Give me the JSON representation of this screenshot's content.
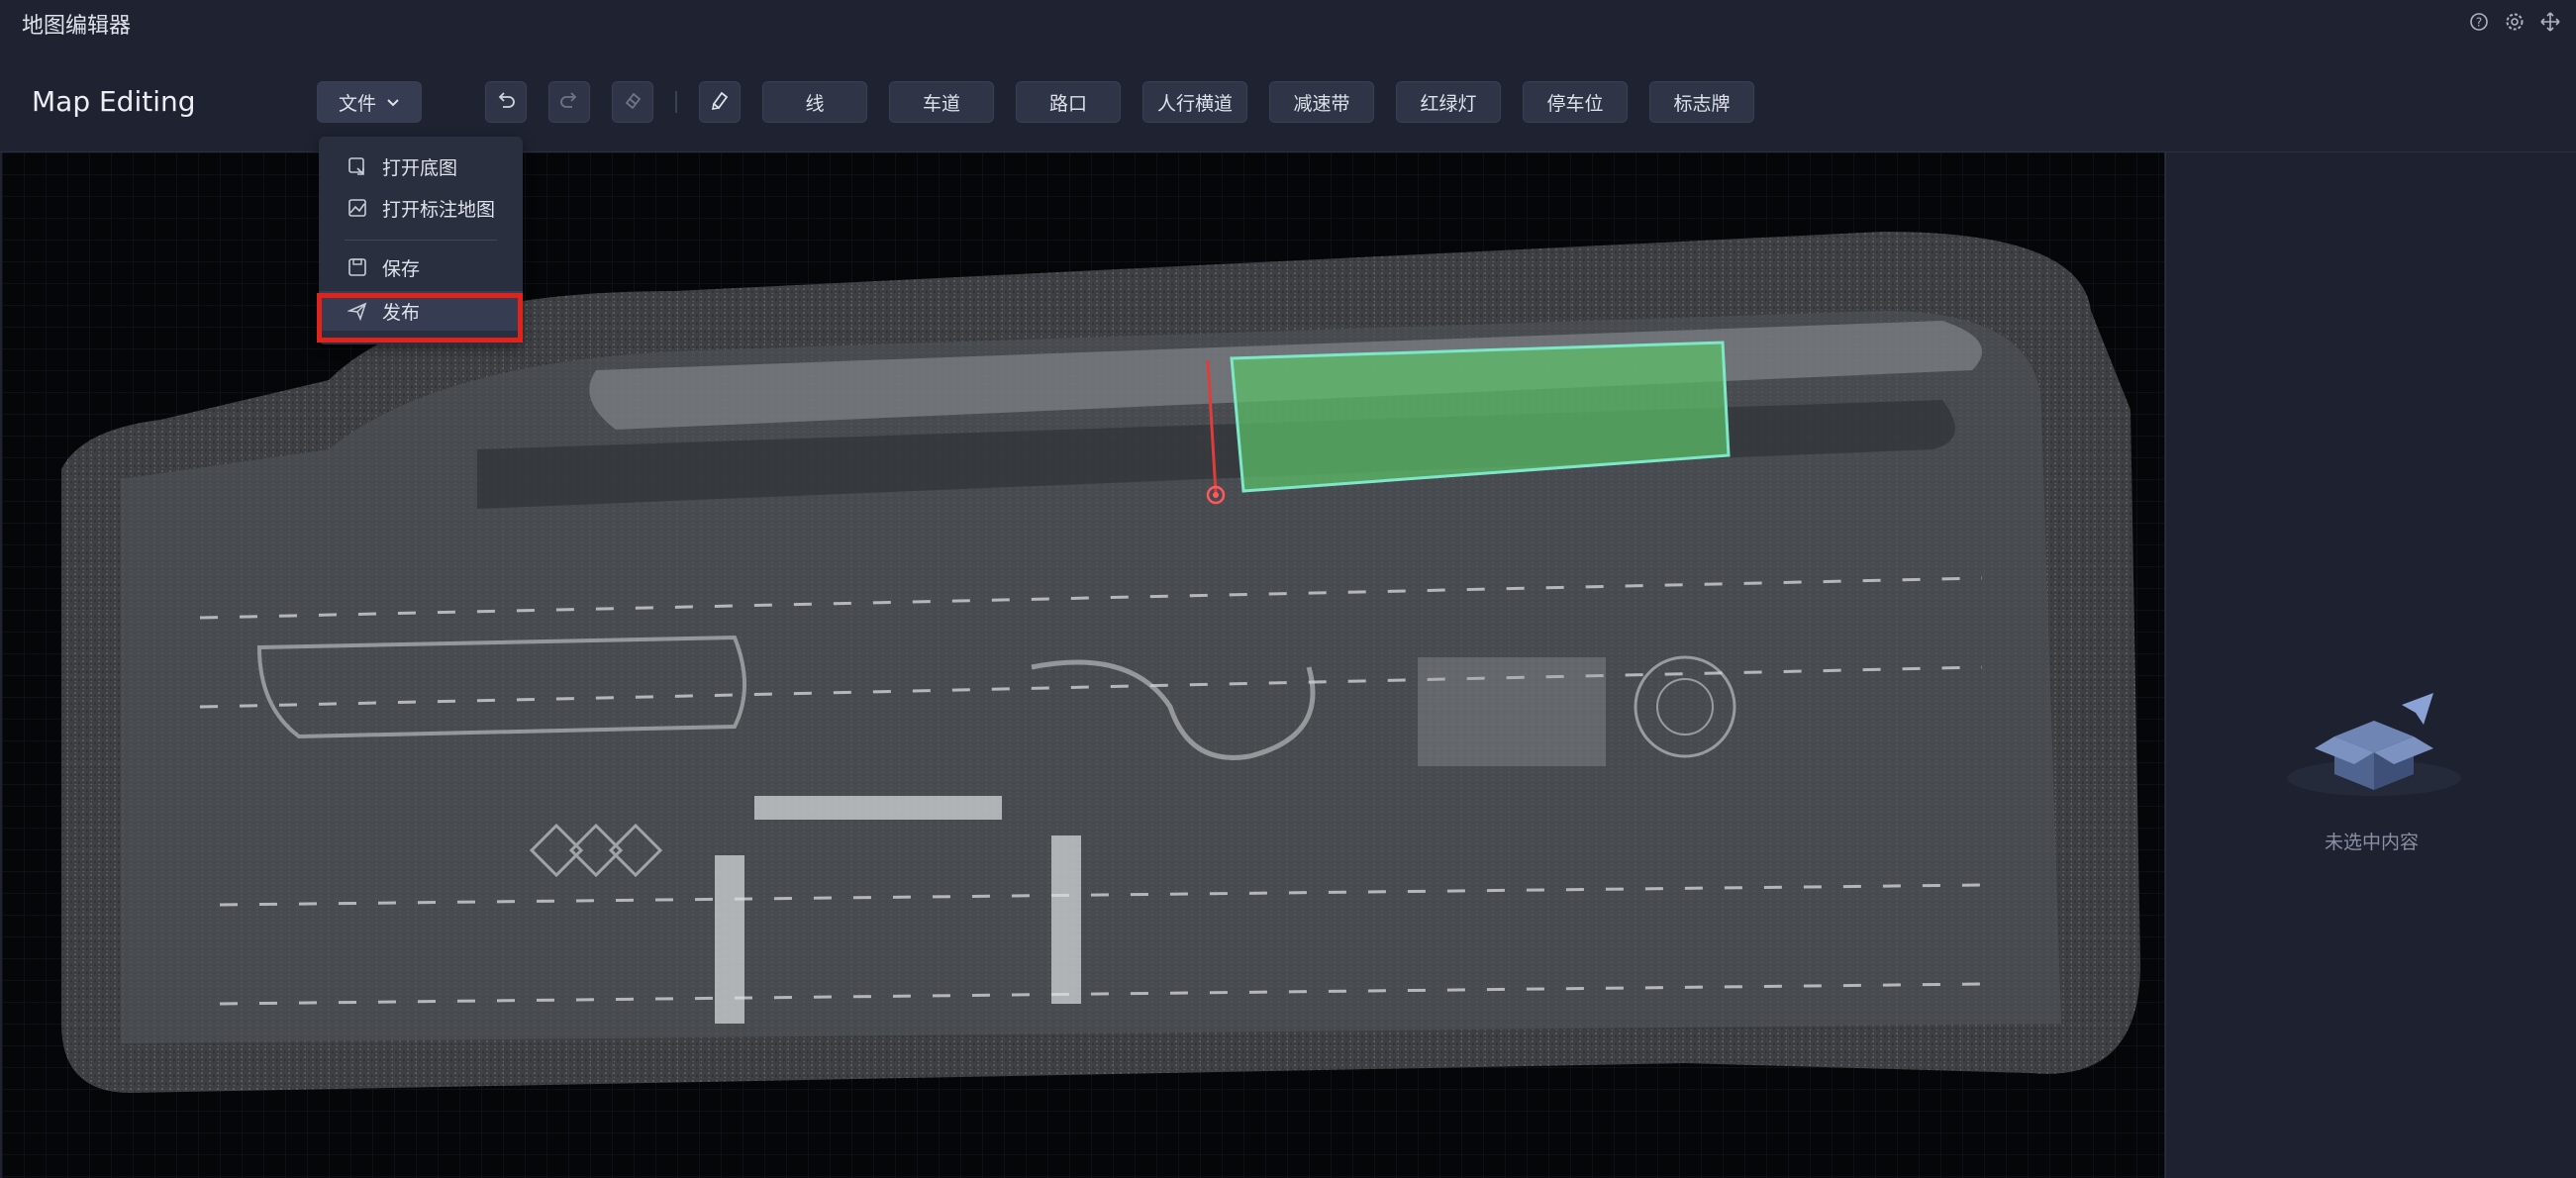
{
  "window": {
    "title": "地图编辑器"
  },
  "header": {
    "page_title": "Map Editing",
    "file_button": "文件",
    "tools": [
      "线",
      "车道",
      "路口",
      "人行横道",
      "减速带",
      "红绿灯",
      "停车位",
      "标志牌"
    ]
  },
  "file_menu": {
    "items": [
      {
        "label": "打开底图",
        "icon": "open-basemap-icon"
      },
      {
        "label": "打开标注地图",
        "icon": "open-annotated-map-icon"
      },
      {
        "label": "保存",
        "icon": "save-icon"
      },
      {
        "label": "发布",
        "icon": "publish-icon"
      }
    ],
    "highlighted": "发布"
  },
  "panel": {
    "empty_text": "未选中内容"
  },
  "colors": {
    "background": "#1f2331",
    "button": "#2f3547",
    "selection_fill": "#5cc26a",
    "highlight_border": "#e0241c",
    "anchor_line": "#e23b3b"
  }
}
